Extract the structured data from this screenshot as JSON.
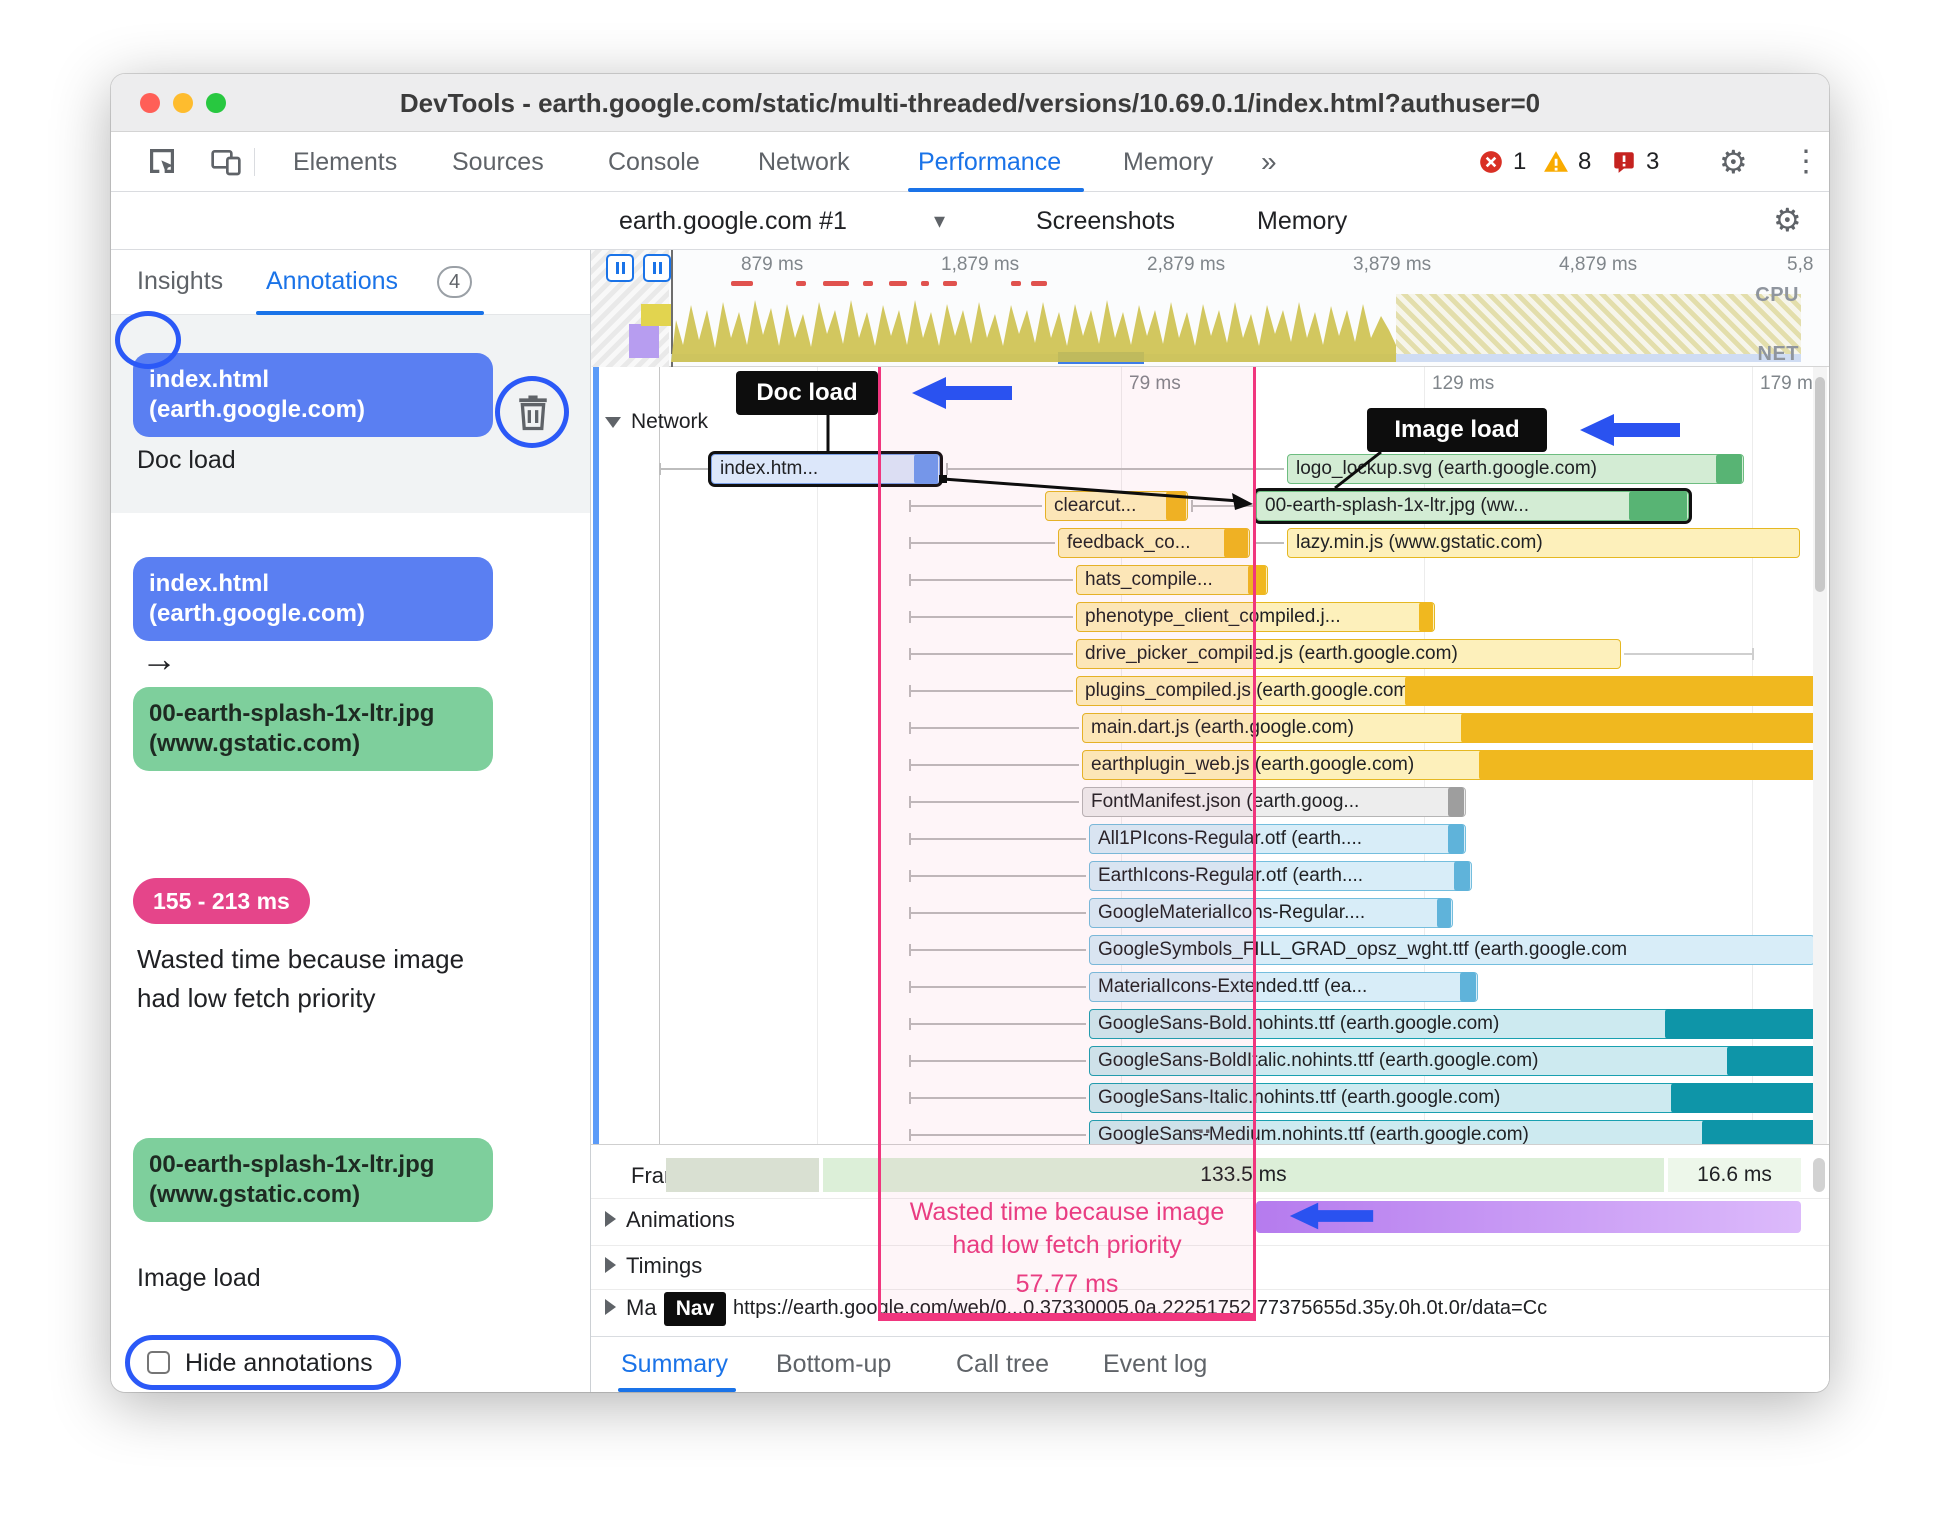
{
  "window": {
    "title": "DevTools - earth.google.com/static/multi-threaded/versions/10.69.0.1/index.html?authuser=0"
  },
  "devtools_tabs": {
    "items": [
      "Elements",
      "Sources",
      "Console",
      "Network",
      "Performance",
      "Memory"
    ],
    "more": "»",
    "error_count": "1",
    "warning_count": "8",
    "issue_count": "3"
  },
  "toolbar": {
    "target": "earth.google.com #1",
    "screenshots": "Screenshots",
    "memory": "Memory"
  },
  "sidebar": {
    "tabs": {
      "insights": "Insights",
      "annotations": "Annotations",
      "badge": "4"
    },
    "cards": [
      {
        "pill": "index.html (earth.google.com)",
        "label": "Doc load"
      },
      {
        "from": "index.html (earth.google.com)",
        "arrow": "→",
        "to": "00-earth-splash-1x-ltr.jpg (www.gstatic.com)"
      },
      {
        "range": "155 - 213 ms",
        "label": "Wasted time because image had low fetch priority"
      },
      {
        "pill": "00-earth-splash-1x-ltr.jpg (www.gstatic.com)",
        "label": "Image load"
      }
    ],
    "hide_annotations": "Hide annotations"
  },
  "overview": {
    "ruler": [
      "879 ms",
      "1,879 ms",
      "2,879 ms",
      "3,879 ms",
      "4,879 ms",
      "5,8"
    ],
    "cpu": "CPU",
    "net": "NET"
  },
  "timeline": {
    "times": [
      "79 ms",
      "129 ms",
      "179 m"
    ],
    "network": "Network",
    "doc_load": "Doc load",
    "image_load": "Image load",
    "overflow": "...",
    "requests": [
      {
        "label": "index.htm..."
      },
      {
        "label": "logo_lockup.svg (earth.google.com)"
      },
      {
        "label": "clearcut..."
      },
      {
        "label": "00-earth-splash-1x-ltr.jpg (ww..."
      },
      {
        "label": "feedback_co..."
      },
      {
        "label": "lazy.min.js (www.gstatic.com)"
      },
      {
        "label": "hats_compile..."
      },
      {
        "label": "phenotype_client_compiled.j..."
      },
      {
        "label": "drive_picker_compiled.js (earth.google.com)"
      },
      {
        "label": "plugins_compiled.js (earth.google.com)"
      },
      {
        "label": "main.dart.js (earth.google.com)"
      },
      {
        "label": "earthplugin_web.js (earth.google.com)"
      },
      {
        "label": "FontManifest.json (earth.goog..."
      },
      {
        "label": "All1PIcons-Regular.otf (earth...."
      },
      {
        "label": "EarthIcons-Regular.otf (earth...."
      },
      {
        "label": "GoogleMaterialIcons-Regular...."
      },
      {
        "label": "GoogleSymbols_FILL_GRAD_opsz_wght.ttf (earth.google.com"
      },
      {
        "label": "MaterialIcons-Extended.ttf (ea..."
      },
      {
        "label": "GoogleSans-Bold.nohints.ttf (earth.google.com)"
      },
      {
        "label": "GoogleSans-BoldItalic.nohints.ttf (earth.google.com)"
      },
      {
        "label": "GoogleSans-Italic.nohints.ttf (earth.google.com)"
      },
      {
        "label": "GoogleSans-Medium.nohints.ttf (earth.google.com)"
      }
    ]
  },
  "tracks": {
    "frames": {
      "label": "Frames",
      "d1": "133.5 ms",
      "d2": "16.6 ms"
    },
    "animations": "Animations",
    "timings": "Timings",
    "main": {
      "label": "Ma",
      "nav": "Nav",
      "url": "https://earth.google.com/web/0...0.37330005.0a.22251752.77375655d.35y.0h.0t.0r/data=Cc"
    }
  },
  "annotation_overlay": {
    "line1": "Wasted time because image",
    "line2": "had low fetch priority",
    "ms": "57.77 ms"
  },
  "bottom_tabs": {
    "items": [
      "Summary",
      "Bottom-up",
      "Call tree",
      "Event log"
    ]
  },
  "colors": {
    "accent": "#1a73e8",
    "annotation_blue": "#5a7ff2",
    "annotation_green": "#7ecf9c",
    "annotation_pink": "#e5458a",
    "circle_blue": "#2b59f7",
    "arrow_blue": "#2a52f0"
  }
}
